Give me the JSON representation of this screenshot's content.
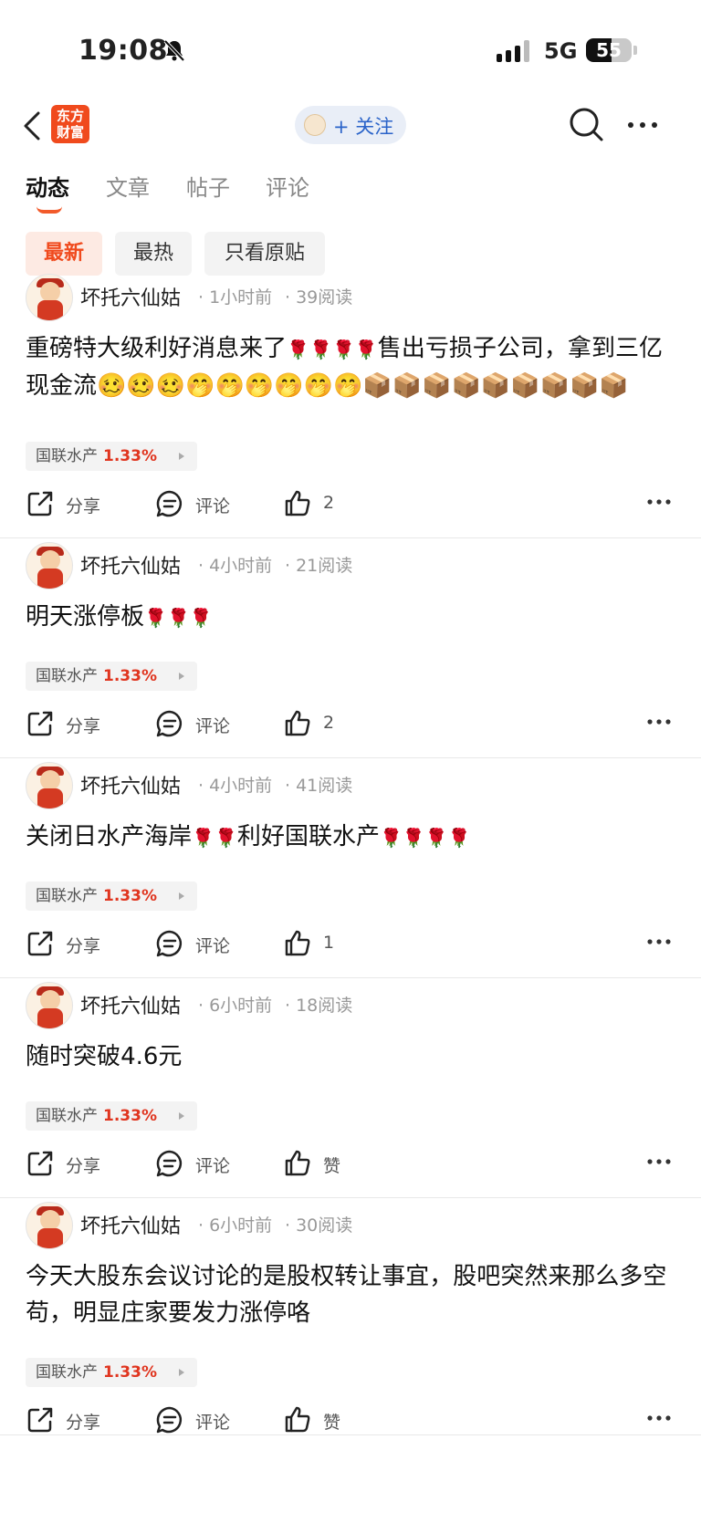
{
  "status_bar": {
    "time": "19:08",
    "network": "5G",
    "battery": "55",
    "battery_level": 0.55
  },
  "nav": {
    "logo_text": "东方财富",
    "follow_label": "+ 关注"
  },
  "tabs": [
    {
      "label": "动态",
      "active": true
    },
    {
      "label": "文章",
      "active": false
    },
    {
      "label": "帖子",
      "active": false
    },
    {
      "label": "评论",
      "active": false
    }
  ],
  "filters": [
    {
      "label": "最新",
      "active": true
    },
    {
      "label": "最热",
      "active": false
    },
    {
      "label": "只看原贴",
      "active": false
    }
  ],
  "posts": [
    {
      "author": "坏托六仙姑",
      "time": "1小时前",
      "reads": "39阅读",
      "content": "重磅特大级利好消息来了🌹🌹🌹🌹售出亏损子公司，拿到三亿现金流🥴🥴🥴🤭🤭🤭🤭🤭🤭📦📦📦📦📦📦📦📦📦",
      "tag_name": "国联水产",
      "tag_pct": "1.33%",
      "share": "分享",
      "comment": "评论",
      "like": "2"
    },
    {
      "author": "坏托六仙姑",
      "time": "4小时前",
      "reads": "21阅读",
      "content": "明天涨停板🌹🌹🌹",
      "tag_name": "国联水产",
      "tag_pct": "1.33%",
      "share": "分享",
      "comment": "评论",
      "like": "2"
    },
    {
      "author": "坏托六仙姑",
      "time": "4小时前",
      "reads": "41阅读",
      "content": "关闭日水产海岸🌹🌹利好国联水产🌹🌹🌹🌹",
      "tag_name": "国联水产",
      "tag_pct": "1.33%",
      "share": "分享",
      "comment": "评论",
      "like": "1"
    },
    {
      "author": "坏托六仙姑",
      "time": "6小时前",
      "reads": "18阅读",
      "content": "随时突破4.6元",
      "tag_name": "国联水产",
      "tag_pct": "1.33%",
      "share": "分享",
      "comment": "评论",
      "like": "赞"
    },
    {
      "author": "坏托六仙姑",
      "time": "6小时前",
      "reads": "30阅读",
      "content": "今天大股东会议讨论的是股权转让事宜，股吧突然来那么多空苟，明显庄家要发力涨停咯",
      "tag_name": "国联水产",
      "tag_pct": "1.33%",
      "share": "分享",
      "comment": "评论",
      "like": "赞"
    }
  ]
}
